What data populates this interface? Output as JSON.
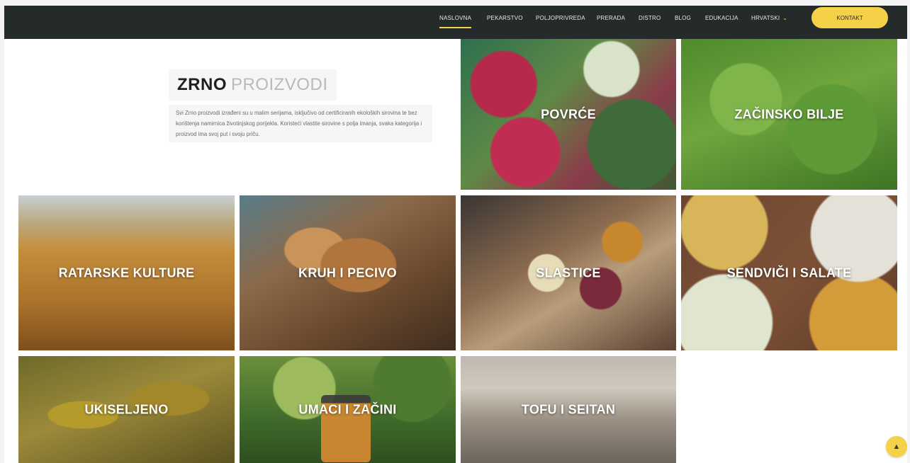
{
  "nav": {
    "items": [
      {
        "label": "NASLOVNA",
        "active": true
      },
      {
        "label": "PEKARSTVO"
      },
      {
        "label": "POLJOPRIVREDA"
      },
      {
        "label": "PRERADA"
      },
      {
        "label": "DISTRO"
      },
      {
        "label": "BLOG"
      },
      {
        "label": "EDUKACIJA"
      },
      {
        "label": "HRVATSKI"
      }
    ],
    "cta_label": "KONTAKT"
  },
  "intro": {
    "title_bold": "ZRNO",
    "title_light": "PROIZVODI",
    "text": "Svi Zrno proizvodi izrađeni su u malim serijama, isključivo od certificiranih ekoloških sirovina te bez korištenja namirnica životinjskog porijekla. Koristeći vlastite sirovine s polja imanja, svaka kategorija i proizvod ima svoj put i svoju priču."
  },
  "tiles": [
    {
      "label": "POVRĆE",
      "image": "vegetables-crates-image"
    },
    {
      "label": "ZAČINSKO BILJE",
      "image": "herbs-field-image"
    },
    {
      "label": "RATARSKE KULTURE",
      "image": "wheat-field-image"
    },
    {
      "label": "KRUH I PECIVO",
      "image": "bread-tray-image"
    },
    {
      "label": "SLASTICE",
      "image": "tarts-image"
    },
    {
      "label": "SENDVIČI I SALATE",
      "image": "salad-bowls-image"
    },
    {
      "label": "UKISELJENO",
      "image": "pickles-jar-image"
    },
    {
      "label": "UMACI I ZAČINI",
      "image": "sauce-jar-image"
    },
    {
      "label": "TOFU I SEITAN",
      "image": "tofu-making-image"
    }
  ],
  "colors": {
    "nav_bg": "#252a2b",
    "accent": "#f4d146"
  },
  "icons": {
    "language_chevron": "chevron-down-icon",
    "scroll_top": "arrow-up-icon"
  }
}
